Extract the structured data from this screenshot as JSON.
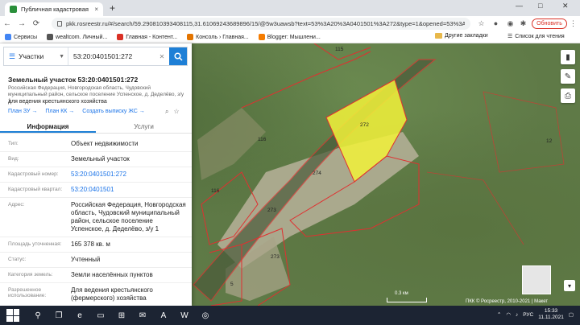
{
  "browser": {
    "tab_title": "Публичная кадастровая карта",
    "tab_close": "×",
    "new_tab": "+",
    "url": "pkk.rosreestr.ru/#/search/59.2908103934081​15,31.61069243689896/15/@5w3uawsb?text=53%3A20%3A0401501%3A272&type=1&opened=53%3A20%3A0401501%3A272",
    "update_button": "Обновить",
    "window_controls": [
      "—",
      "□",
      "✕"
    ],
    "nav": [
      "←",
      "→",
      "⟳"
    ]
  },
  "bookmarks": {
    "items": [
      {
        "label": "Сервисы",
        "color": "#4285f4"
      },
      {
        "label": "wealtcom. Личный...",
        "color": "#555555"
      },
      {
        "label": "Главная - Контент...",
        "color": "#d93025"
      },
      {
        "label": "Консоль › Главная...",
        "color": "#e37400"
      },
      {
        "label": "Blogger: Мышлени...",
        "color": "#f57c00"
      }
    ],
    "other": "Другие закладки",
    "reading": "Список для чтения"
  },
  "search": {
    "category": "Участки",
    "value": "53:20:0401501:272"
  },
  "object": {
    "title": "Земельный участок 53:20:0401501:272",
    "address": "Российская Федерация, Новгородская область, Чудовский муниципальный район, сельское поселение Успенское, д. Деделёво, з/у 1",
    "purpose": "для ведения крестьянского хозяйства",
    "links": [
      "План ЗУ →",
      "План КК →",
      "Создать выписку ЖС →"
    ]
  },
  "tabs": {
    "info": "Информация",
    "services": "Услуги"
  },
  "rows": [
    {
      "k": "Тип:",
      "v": "Объект недвижимости"
    },
    {
      "k": "Вид:",
      "v": "Земельный участок"
    },
    {
      "k": "Кадастровый номер:",
      "v": "53:20:0401501:272",
      "link": true
    },
    {
      "k": "Кадастровый квартал:",
      "v": "53:20:0401501",
      "link": true
    },
    {
      "k": "Адрес:",
      "v": "Российская Федерация, Новгородская область, Чудовский муниципальный район, сельское поселение Успенское, д. Деделёво, з/у 1"
    },
    {
      "k": "Площадь уточненная:",
      "v": "165 378 кв. м"
    },
    {
      "k": "Статус:",
      "v": "Учтенный"
    },
    {
      "k": "Категория земель:",
      "v": "Земли населённых пунктов"
    },
    {
      "k": "Разрешенное использование:",
      "v": "Для ведения крестьянского (фермерского) хозяйства"
    }
  ],
  "map": {
    "labels": [
      {
        "t": "115"
      },
      {
        "t": "272"
      },
      {
        "t": "274"
      },
      {
        "t": "116"
      },
      {
        "t": "273"
      },
      {
        "t": "273"
      },
      {
        "t": "12"
      },
      {
        "t": "5"
      },
      {
        "t": "116"
      }
    ],
    "scale": "0.3 км",
    "copyright": "ПКК © Росреестр, 2010-2021 | Макет",
    "highlight_color": "#f2f23a"
  },
  "taskbar": {
    "time": "15:33",
    "date": "11.11.2021",
    "lang": "РУС"
  }
}
